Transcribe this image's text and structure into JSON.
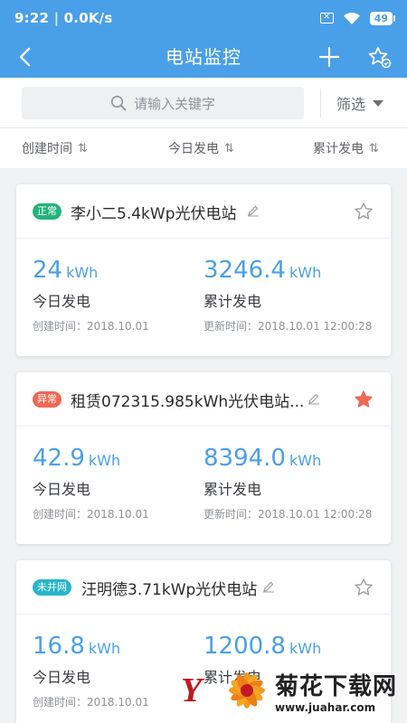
{
  "status_bar": {
    "time": "9:22",
    "speed": "0.0K/s",
    "battery": "49"
  },
  "nav": {
    "title": "电站监控"
  },
  "search": {
    "placeholder": "请输入关键字",
    "filter_label": "筛选"
  },
  "sort": [
    {
      "label": "创建时间",
      "arrows": "⇅"
    },
    {
      "label": "今日发电",
      "arrows": "⇅"
    },
    {
      "label": "累计发电",
      "arrows": "⇅"
    }
  ],
  "stations": [
    {
      "status": "正常",
      "name": "李小二5.4kWp光伏电站",
      "today_value": "24",
      "today_unit": "kWh",
      "today_label": "今日发电",
      "total_value": "3246.4",
      "total_unit": "kWh",
      "total_label": "累计发电",
      "created": "创建时间：2018.10.01",
      "updated": "更新时间：2018.10.01 12:00:28",
      "starred": false
    },
    {
      "status": "异常",
      "name": "租赁072315.985kWh光伏电站...",
      "today_value": "42.9",
      "today_unit": "kWh",
      "today_label": "今日发电",
      "total_value": "8394.0",
      "total_unit": "kWh",
      "total_label": "累计发电",
      "created": "创建时间：2018.10.01",
      "updated": "更新时间：2018.10.01 12:00:28",
      "starred": true
    },
    {
      "status": "未并网",
      "name": "汪明德3.71kWp光伏电站",
      "today_value": "16.8",
      "today_unit": "kWh",
      "today_label": "今日发电",
      "total_value": "1200.8",
      "total_unit": "kWh",
      "total_label": "累计发电",
      "created": "创建时间：2018.10.01",
      "updated": "",
      "starred": false
    }
  ],
  "watermark": {
    "brand": "菊花下载网",
    "url": "www.juahar.com"
  },
  "colors": {
    "primary": "#4a9fe9",
    "normal": "#24b37b",
    "error": "#ef6856",
    "offgrid": "#27b6c9",
    "star_active": "#ef6856"
  }
}
